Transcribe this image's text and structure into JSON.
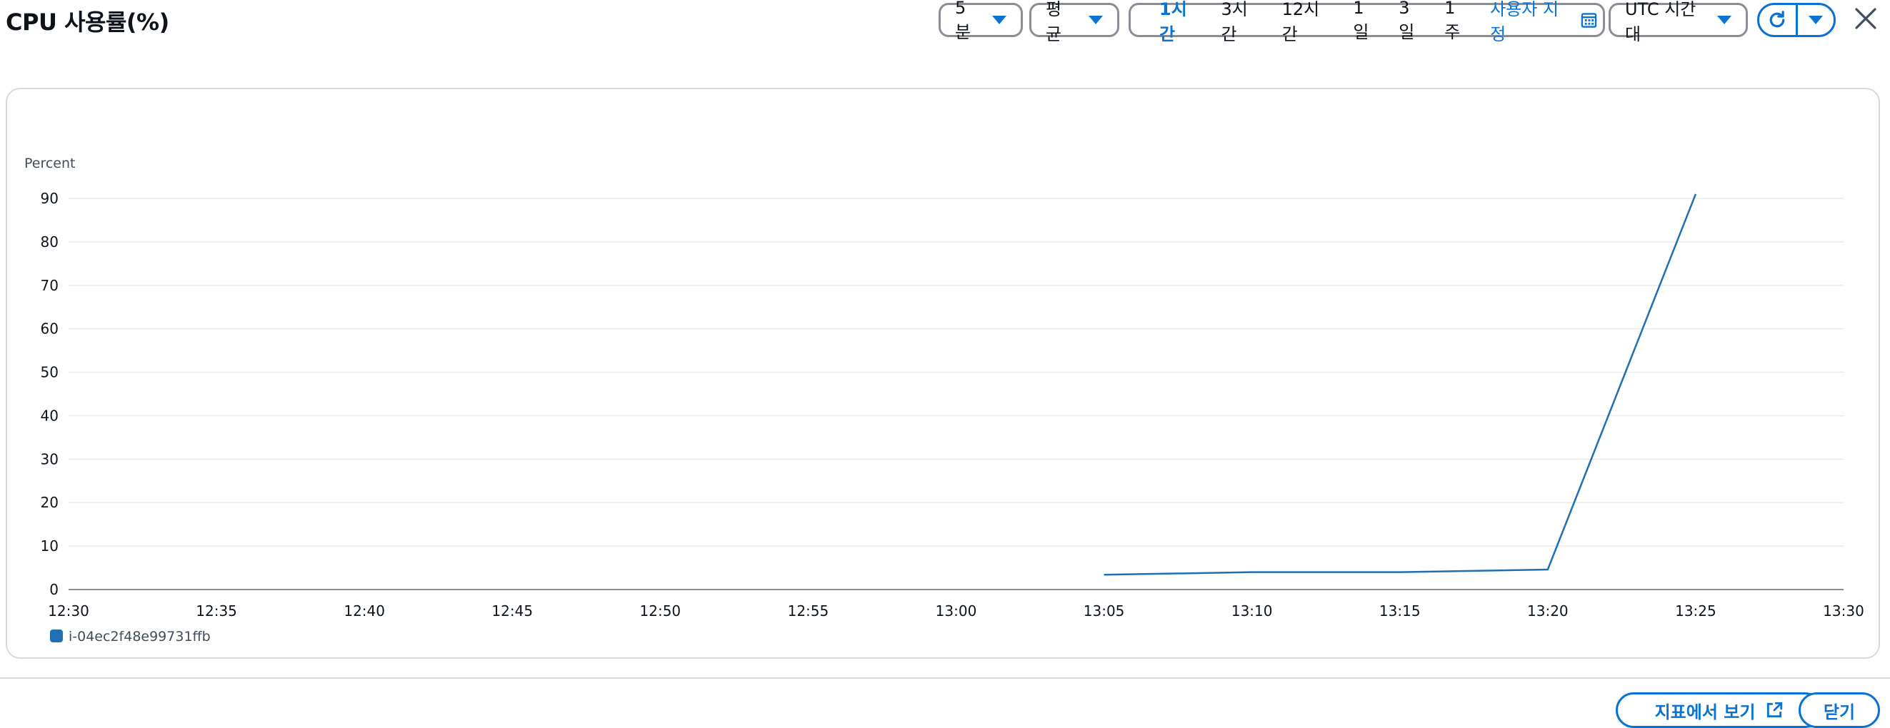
{
  "header": {
    "title": "CPU 사용률(%)",
    "period": "5분",
    "statistic": "평균",
    "time_ranges": [
      "1시간",
      "3시간",
      "12시간",
      "1일",
      "3일",
      "1주"
    ],
    "active_range": "1시간",
    "custom_range": "사용자 지정",
    "timezone": "UTC 시간대"
  },
  "footer": {
    "view_in_metrics": "지표에서 보기",
    "close": "닫기"
  },
  "colors": {
    "accent": "#0972d3",
    "series": "#1f6fb2",
    "grid": "#e9ebed",
    "axis": "#8c8c94"
  },
  "icons": [
    "calendar-icon",
    "refresh-icon",
    "chevron-down-icon",
    "close-icon",
    "external-link-icon"
  ],
  "chart_data": {
    "type": "line",
    "ylabel": "Percent",
    "ylim": [
      0,
      90
    ],
    "yticks": [
      0,
      10,
      20,
      30,
      40,
      50,
      60,
      70,
      80,
      90
    ],
    "xticks": [
      "12:30",
      "12:35",
      "12:40",
      "12:45",
      "12:50",
      "12:55",
      "13:00",
      "13:05",
      "13:10",
      "13:15",
      "13:20",
      "13:25",
      "13:30"
    ],
    "grid": true,
    "legend_position": "bottom-left",
    "series": [
      {
        "name": "i-04ec2f48e99731ffb",
        "x": [
          "13:05",
          "13:10",
          "13:15",
          "13:20",
          "13:25"
        ],
        "values": [
          3.4,
          4.0,
          4.0,
          4.6,
          91
        ]
      }
    ]
  }
}
